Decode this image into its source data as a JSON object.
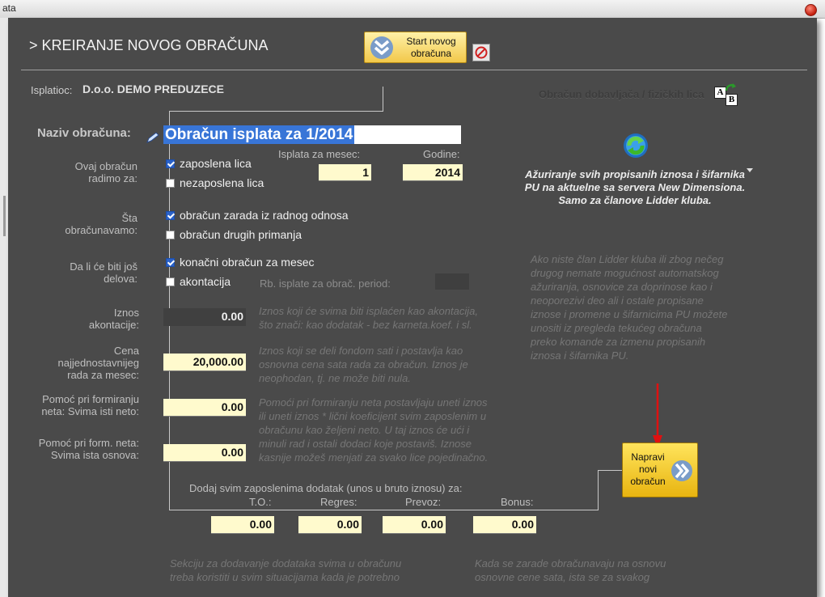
{
  "window": {
    "title": "ata"
  },
  "header": {
    "title": "> KREIRANJE NOVOG OBRAČUNA",
    "start_button_line1": "Start novog",
    "start_button_line2": "obračuna"
  },
  "payer": {
    "label": "Isplatioc:",
    "value": "D.o.o. DEMO PREDUZECE"
  },
  "name": {
    "label": "Naziv obračuna:",
    "value": "Obračun isplata za 1/2014"
  },
  "period": {
    "month_label": "Isplata za mesec:",
    "month_value": "1",
    "year_label": "Godine:",
    "year_value": "2014"
  },
  "who": {
    "label_line1": "Ovaj obračun",
    "label_line2": "radimo za:",
    "opt1": "zaposlena lica",
    "opt1_checked": true,
    "opt2": "nezaposlena lica",
    "opt2_checked": false
  },
  "what": {
    "label_line1": "Šta",
    "label_line2": "obračunavamo:",
    "opt1": "obračun zarada iz radnog odnosa",
    "opt1_checked": true,
    "opt2": "obračun drugih primanja",
    "opt2_checked": false
  },
  "parts": {
    "label_line1": "Da li će biti još",
    "label_line2": "delova:",
    "opt1": "konačni obračun za mesec",
    "opt1_checked": true,
    "opt2": "akontacija",
    "opt2_checked": false,
    "rb_label": "Rb. isplate za obrač. period:"
  },
  "advance": {
    "label_line1": "Iznos",
    "label_line2": "akontacije:",
    "value": "0.00",
    "hint_line1": "Iznos koji će svima biti isplaćen kao akontacija,",
    "hint_line2": "što znači: kao dodatak - bez karneta.koef. i sl."
  },
  "price": {
    "label_line1": "Cena",
    "label_line2": "najjednostavnijeg",
    "label_line3": "rada za mesec:",
    "value": "20,000.00",
    "hint_line1": "Iznos koji se deli fondom sati i postavlja kao",
    "hint_line2": "osnovna cena sata rada za obračun. Iznos je",
    "hint_line3": "neophodan, tj. ne može biti nula."
  },
  "net_help": {
    "label_line1": "Pomoć pri formiranju",
    "label_line2": "neta: Svima isti neto:",
    "value": "0.00",
    "hint_line1": "Pomoći pri formiranju neta postavljaju uneti iznos",
    "hint_line2": "ili uneti iznos * lični koeficijent svim zaposlenim u",
    "hint_line3": "obračunu kao željeni neto. U taj iznos će ući i",
    "hint_line4": "minuli rad i ostali dodaci koje postaviš. Iznose",
    "hint_line5": "kasnije možeš menjati za svako lice pojedinačno."
  },
  "base_help": {
    "label_line1": "Pomoć pri form. neta:",
    "label_line2": "Svima ista osnova:",
    "value": "0.00"
  },
  "addons": {
    "title": "Dodaj svim zaposlenima dodatak (unos u bruto iznosu) za:",
    "to_label": "T.O.:",
    "regres_label": "Regres:",
    "prevoz_label": "Prevoz:",
    "bonus_label": "Bonus:",
    "to_value": "0.00",
    "regres_value": "0.00",
    "prevoz_value": "0.00",
    "bonus_value": "0.00"
  },
  "bottom_hints": {
    "left_line1": "Sekciju za dodavanje dodataka svima u obračunu",
    "left_line2": "treba koristiti u svim situacijama kada je potrebno",
    "right_line1": "Kada se zarade obračunavaju na osnovu",
    "right_line2": "osnovne cene sata, ista se za svakog"
  },
  "right_panel": {
    "supplier_label": "Obračun dobavljača / fizičkih lica",
    "supplier_icon_a": "A",
    "supplier_icon_b": "B",
    "update_line1": "Ažuriranje svih propisanih iznosa i šifarnika",
    "update_line2": "PU na aktuelne sa servera New Dimensiona.",
    "update_line3": "Samo za članove Lidder kluba.",
    "info_line1": "Ako niste član Lidder kluba ili zbog nečeg",
    "info_line2": "drugog nemate mogućnost automatskog",
    "info_line3": "ažuriranja, osnovice za doprinose kao i",
    "info_line4": "neoporezivi deo ali i ostale propisane",
    "info_line5": "iznose i promene u šifarnicima PU možete",
    "info_line6": "unositi iz pregleda tekućeg obračuna",
    "info_line7": "preko komande za izmenu propisanih",
    "info_line8": "iznosa i šifarnika PU.",
    "create_line1": "Napravi",
    "create_line2": "novi",
    "create_line3": "obračun"
  },
  "colors": {
    "panel": "#4a4a4a",
    "field": "#fffacd",
    "accent": "#f2c84a",
    "arrow": "#e01010",
    "selection": "#3875d7"
  }
}
